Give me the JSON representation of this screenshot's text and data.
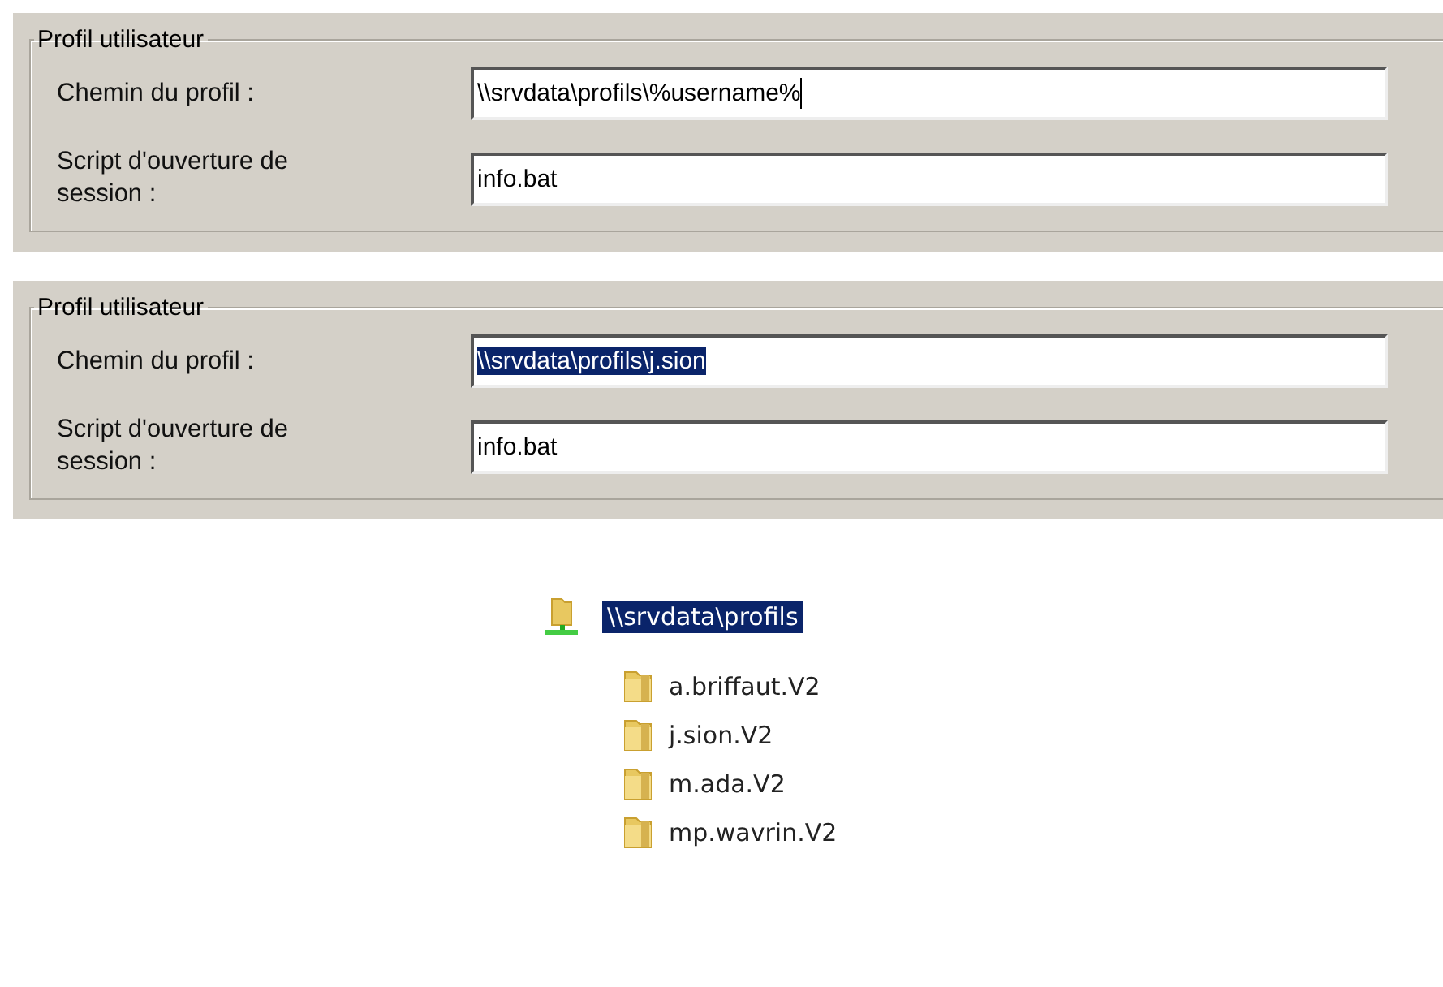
{
  "panels": [
    {
      "title": "Profil utilisateur",
      "fields": [
        {
          "label": "Chemin du profil :",
          "value": "\\\\srvdata\\profils\\%username%",
          "text_selected": false,
          "focused": true
        },
        {
          "label": "Script d'ouverture de session :",
          "value": "info.bat",
          "text_selected": false,
          "focused": false
        }
      ]
    },
    {
      "title": "Profil utilisateur",
      "fields": [
        {
          "label": "Chemin du profil :",
          "value": "\\\\srvdata\\profils\\j.sion",
          "text_selected": true,
          "focused": false
        },
        {
          "label": "Script d'ouverture de session :",
          "value": "info.bat",
          "text_selected": false,
          "focused": false
        }
      ]
    }
  ],
  "tree": {
    "label": "\\\\srvdata\\profils",
    "selected": true,
    "children": [
      {
        "label": "a.briffaut.V2",
        "selected": false
      },
      {
        "label": "j.sion.V2",
        "selected": false
      },
      {
        "label": "m.ada.V2",
        "selected": false
      },
      {
        "label": "mp.wavrin.V2",
        "selected": false
      }
    ]
  }
}
